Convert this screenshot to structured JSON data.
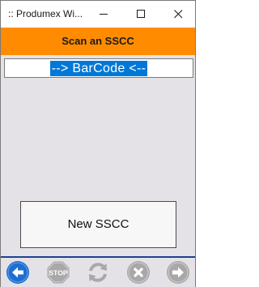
{
  "window": {
    "title": ":: Produmex Wi..."
  },
  "header": {
    "title": "Scan an SSCC"
  },
  "barcode_field": {
    "value": "--> BarCode <--"
  },
  "buttons": {
    "new_sscc": "New SSCC"
  },
  "toolbar": {
    "stop_label": "STOP",
    "items": [
      {
        "icon": "back-arrow-icon",
        "enabled": true
      },
      {
        "icon": "stop-icon",
        "enabled": false
      },
      {
        "icon": "refresh-icon",
        "enabled": false
      },
      {
        "icon": "cancel-icon",
        "enabled": false
      },
      {
        "icon": "forward-arrow-icon",
        "enabled": false
      }
    ]
  },
  "colors": {
    "accent": "#ff8c00",
    "content_bg": "#e4e2e6",
    "selection": "#0078d7",
    "toolbar_border": "#1f3f8f",
    "back_button": "#1e6fd0",
    "disabled_icon": "#a8a8a8"
  }
}
